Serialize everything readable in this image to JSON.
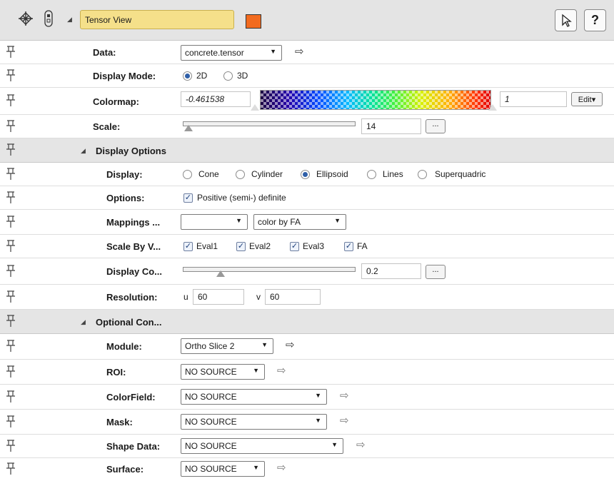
{
  "header": {
    "module_name": "Tensor View",
    "colors": {
      "module_swatch": "#f26b1f",
      "name_field": "#f5e08a"
    },
    "icons": [
      "network-icon",
      "connection-icon",
      "collapse-triangle-icon",
      "pointer-icon",
      "help-icon"
    ],
    "help_label": "?"
  },
  "rows": {
    "data": {
      "label": "Data:",
      "value": "concrete.tensor"
    },
    "display_mode": {
      "label": "Display Mode:",
      "options": [
        "2D",
        "3D"
      ],
      "selected": "2D"
    },
    "colormap": {
      "label": "Colormap:",
      "min": "-0.461538",
      "max": "1",
      "edit": "Edit"
    },
    "scale": {
      "label": "Scale:",
      "value": "14",
      "slider_fraction": 0.02,
      "more": "..."
    }
  },
  "display_options": {
    "title": "Display Options",
    "display": {
      "label": "Display:",
      "options": [
        "Cone",
        "Cylinder",
        "Ellipsoid",
        "Lines",
        "Superquadric"
      ],
      "selected": "Ellipsoid"
    },
    "options": {
      "label": "Options:",
      "checkbox": "Positive (semi-) definite",
      "checked": true
    },
    "mappings": {
      "label": "Mappings ...",
      "first": "",
      "second": "color by FA"
    },
    "scale_by": {
      "label": "Scale By V...",
      "items": [
        "Eval1",
        "Eval2",
        "Eval3",
        "FA"
      ]
    },
    "display_co": {
      "label": "Display Co...",
      "value": "0.2",
      "slider_fraction": 0.2,
      "more": "..."
    },
    "resolution": {
      "label": "Resolution:",
      "u_label": "u",
      "u_value": "60",
      "v_label": "v",
      "v_value": "60"
    }
  },
  "optional_con": {
    "title": "Optional Con...",
    "module": {
      "label": "Module:",
      "value": "Ortho Slice 2"
    },
    "roi": {
      "label": "ROI:",
      "value": "NO SOURCE"
    },
    "colorfield": {
      "label": "ColorField:",
      "value": "NO SOURCE"
    },
    "mask": {
      "label": "Mask:",
      "value": "NO SOURCE"
    },
    "shape_data": {
      "label": "Shape Data:",
      "value": "NO SOURCE"
    },
    "surface": {
      "label": "Surface:",
      "value": "NO SOURCE"
    }
  }
}
